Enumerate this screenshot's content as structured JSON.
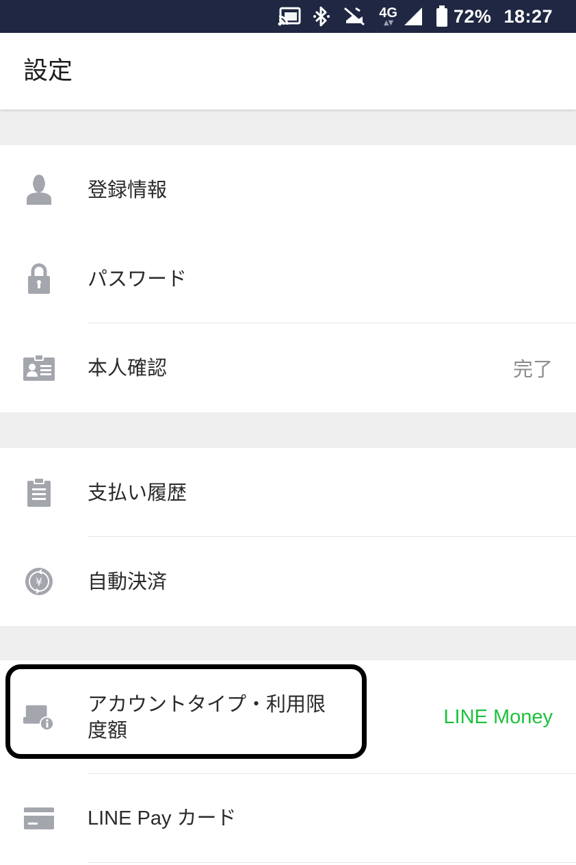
{
  "status_bar": {
    "network": "4G",
    "battery_percent": "72%",
    "time": "18:27",
    "icons": [
      "cast-icon",
      "bluetooth-icon",
      "no-location-icon",
      "4g-icon",
      "signal-icon",
      "battery-icon"
    ]
  },
  "header": {
    "title": "設定"
  },
  "sections": [
    {
      "items": [
        {
          "label": "登録情報",
          "icon": "person-icon",
          "value": ""
        },
        {
          "label": "パスワード",
          "icon": "lock-icon",
          "value": ""
        },
        {
          "label": "本人確認",
          "icon": "id-card-icon",
          "value": "完了"
        }
      ]
    },
    {
      "items": [
        {
          "label": "支払い履歴",
          "icon": "clipboard-icon",
          "value": ""
        },
        {
          "label": "自動決済",
          "icon": "yen-cycle-icon",
          "value": ""
        }
      ]
    },
    {
      "items": [
        {
          "label": "アカウントタイプ・利用限度額",
          "icon": "account-info-icon",
          "value": "LINE Money"
        },
        {
          "label": "LINE Pay カード",
          "icon": "card-icon",
          "value": ""
        }
      ]
    }
  ],
  "colors": {
    "status_bar_bg": "#1f2742",
    "icon_gray": "#a4a6ad",
    "accent_green": "#1ec13c",
    "section_gap": "#efefef"
  }
}
